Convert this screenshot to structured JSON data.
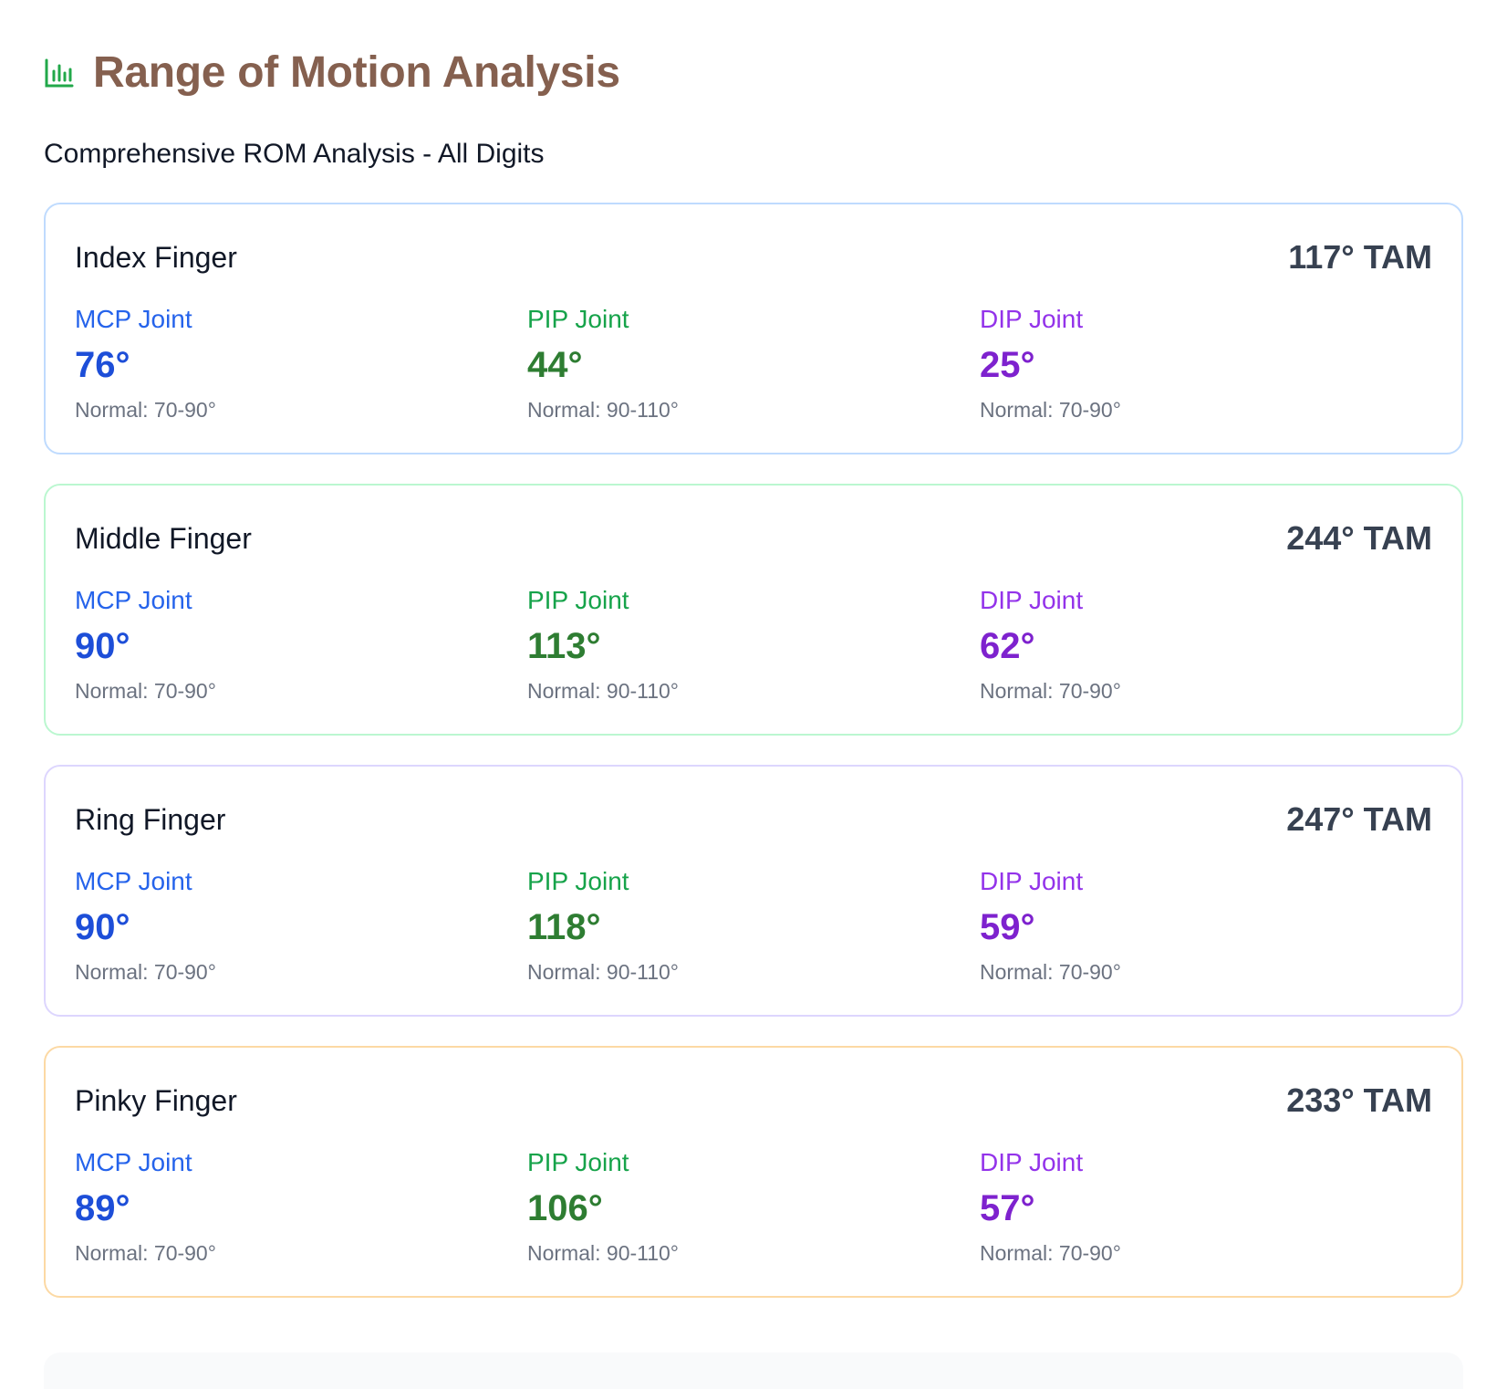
{
  "header": {
    "icon": "bar-chart-icon",
    "icon_color": "#22a84a",
    "title": "Range of Motion Analysis",
    "title_color": "#85604f"
  },
  "subtitle": "Comprehensive ROM Analysis - All Digits",
  "fingers": [
    {
      "name": "Index Finger",
      "tam": "117° TAM",
      "border_color": "#bfdbfe",
      "joints": [
        {
          "label": "MCP Joint",
          "value": "76°",
          "normal": "Normal: 70-90°"
        },
        {
          "label": "PIP Joint",
          "value": "44°",
          "normal": "Normal: 90-110°"
        },
        {
          "label": "DIP Joint",
          "value": "25°",
          "normal": "Normal: 70-90°"
        }
      ]
    },
    {
      "name": "Middle Finger",
      "tam": "244° TAM",
      "border_color": "#bbf7d0",
      "joints": [
        {
          "label": "MCP Joint",
          "value": "90°",
          "normal": "Normal: 70-90°"
        },
        {
          "label": "PIP Joint",
          "value": "113°",
          "normal": "Normal: 90-110°"
        },
        {
          "label": "DIP Joint",
          "value": "62°",
          "normal": "Normal: 70-90°"
        }
      ]
    },
    {
      "name": "Ring Finger",
      "tam": "247° TAM",
      "border_color": "#ddd6fe",
      "joints": [
        {
          "label": "MCP Joint",
          "value": "90°",
          "normal": "Normal: 70-90°"
        },
        {
          "label": "PIP Joint",
          "value": "118°",
          "normal": "Normal: 90-110°"
        },
        {
          "label": "DIP Joint",
          "value": "59°",
          "normal": "Normal: 70-90°"
        }
      ]
    },
    {
      "name": "Pinky Finger",
      "tam": "233° TAM",
      "border_color": "#fcd9a4",
      "joints": [
        {
          "label": "MCP Joint",
          "value": "89°",
          "normal": "Normal: 70-90°"
        },
        {
          "label": "PIP Joint",
          "value": "106°",
          "normal": "Normal: 90-110°"
        },
        {
          "label": "DIP Joint",
          "value": "57°",
          "normal": "Normal: 70-90°"
        }
      ]
    }
  ],
  "colors": {
    "mcp": "#1d4ed8",
    "pip": "#2e7d32",
    "dip": "#7e22ce"
  }
}
